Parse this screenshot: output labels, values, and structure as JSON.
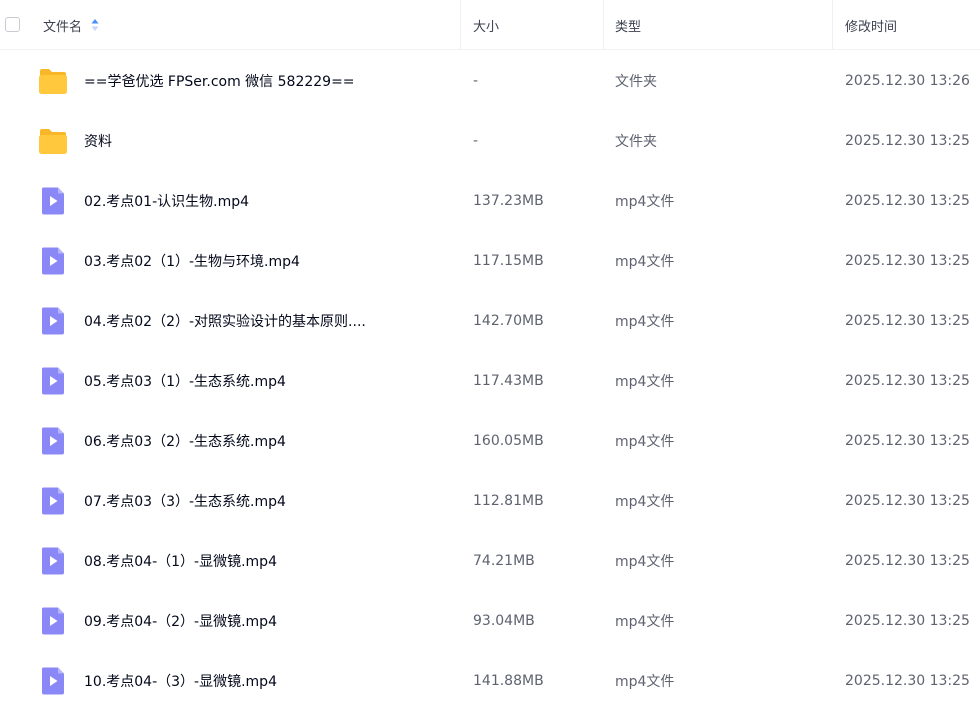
{
  "header": {
    "name": "文件名",
    "size": "大小",
    "type": "类型",
    "mtime": "修改时间"
  },
  "colors": {
    "folder": "#ffc83d",
    "folder_back": "#f7b728",
    "video": "#8a87f6",
    "sort_up": "#4a8cff",
    "sort_down": "#c8d6f5"
  },
  "rows": [
    {
      "icon": "folder-icon",
      "name": "==学爸优选 FPSer.com 微信 582229==",
      "size": "-",
      "type": "文件夹",
      "mtime": "2025.12.30 13:26"
    },
    {
      "icon": "folder-icon",
      "name": "资料",
      "size": "-",
      "type": "文件夹",
      "mtime": "2025.12.30 13:25"
    },
    {
      "icon": "video-file-icon",
      "name": "02.考点01-认识生物.mp4",
      "size": "137.23MB",
      "type": "mp4文件",
      "mtime": "2025.12.30 13:25"
    },
    {
      "icon": "video-file-icon",
      "name": "03.考点02（1）-生物与环境.mp4",
      "size": "117.15MB",
      "type": "mp4文件",
      "mtime": "2025.12.30 13:25"
    },
    {
      "icon": "video-file-icon",
      "name": "04.考点02（2）-对照实验设计的基本原则....",
      "size": "142.70MB",
      "type": "mp4文件",
      "mtime": "2025.12.30 13:25"
    },
    {
      "icon": "video-file-icon",
      "name": "05.考点03（1）-生态系统.mp4",
      "size": "117.43MB",
      "type": "mp4文件",
      "mtime": "2025.12.30 13:25"
    },
    {
      "icon": "video-file-icon",
      "name": "06.考点03（2）-生态系统.mp4",
      "size": "160.05MB",
      "type": "mp4文件",
      "mtime": "2025.12.30 13:25"
    },
    {
      "icon": "video-file-icon",
      "name": "07.考点03（3）-生态系统.mp4",
      "size": "112.81MB",
      "type": "mp4文件",
      "mtime": "2025.12.30 13:25"
    },
    {
      "icon": "video-file-icon",
      "name": "08.考点04-（1）-显微镜.mp4",
      "size": "74.21MB",
      "type": "mp4文件",
      "mtime": "2025.12.30 13:25"
    },
    {
      "icon": "video-file-icon",
      "name": "09.考点04-（2）-显微镜.mp4",
      "size": "93.04MB",
      "type": "mp4文件",
      "mtime": "2025.12.30 13:25"
    },
    {
      "icon": "video-file-icon",
      "name": "10.考点04-（3）-显微镜.mp4",
      "size": "141.88MB",
      "type": "mp4文件",
      "mtime": "2025.12.30 13:25"
    }
  ]
}
